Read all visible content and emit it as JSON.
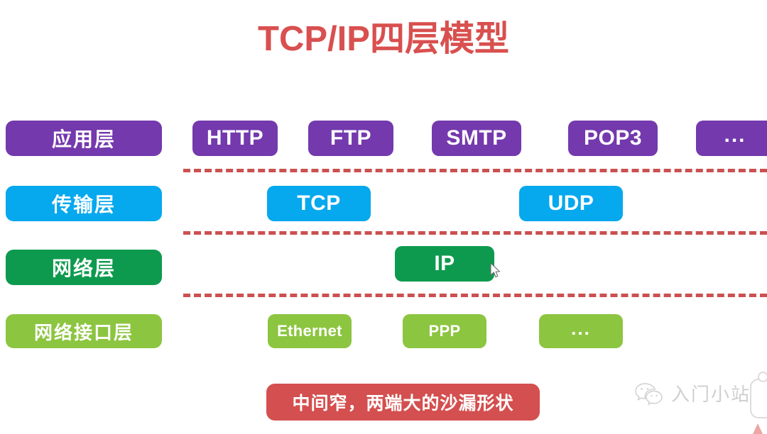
{
  "title": "TCP/IP四层模型",
  "title_color": "#d8504f",
  "layers": [
    {
      "name": "application",
      "label": "应用层",
      "color": "#7439ad",
      "protocols": [
        {
          "label": "HTTP",
          "name": "http"
        },
        {
          "label": "FTP",
          "name": "ftp"
        },
        {
          "label": "SMTP",
          "name": "smtp"
        },
        {
          "label": "POP3",
          "name": "pop3"
        },
        {
          "label": "...",
          "name": "more"
        }
      ]
    },
    {
      "name": "transport",
      "label": "传输层",
      "color": "#06a8ee",
      "protocols": [
        {
          "label": "TCP",
          "name": "tcp"
        },
        {
          "label": "UDP",
          "name": "udp"
        }
      ]
    },
    {
      "name": "network",
      "label": "网络层",
      "color": "#0e9a4e",
      "protocols": [
        {
          "label": "IP",
          "name": "ip"
        }
      ]
    },
    {
      "name": "network-interface",
      "label": "网络接口层",
      "color": "#8cc540",
      "protocols": [
        {
          "label": "Ethernet",
          "name": "ethernet"
        },
        {
          "label": "PPP",
          "name": "ppp"
        },
        {
          "label": "...",
          "name": "more"
        }
      ]
    }
  ],
  "separator_color": "#cb5050",
  "caption": {
    "text": "中间窄，两端大的沙漏形状",
    "color": "#d44f4f"
  },
  "watermark": {
    "text": "入门小站",
    "icon": "wechat-icon"
  }
}
